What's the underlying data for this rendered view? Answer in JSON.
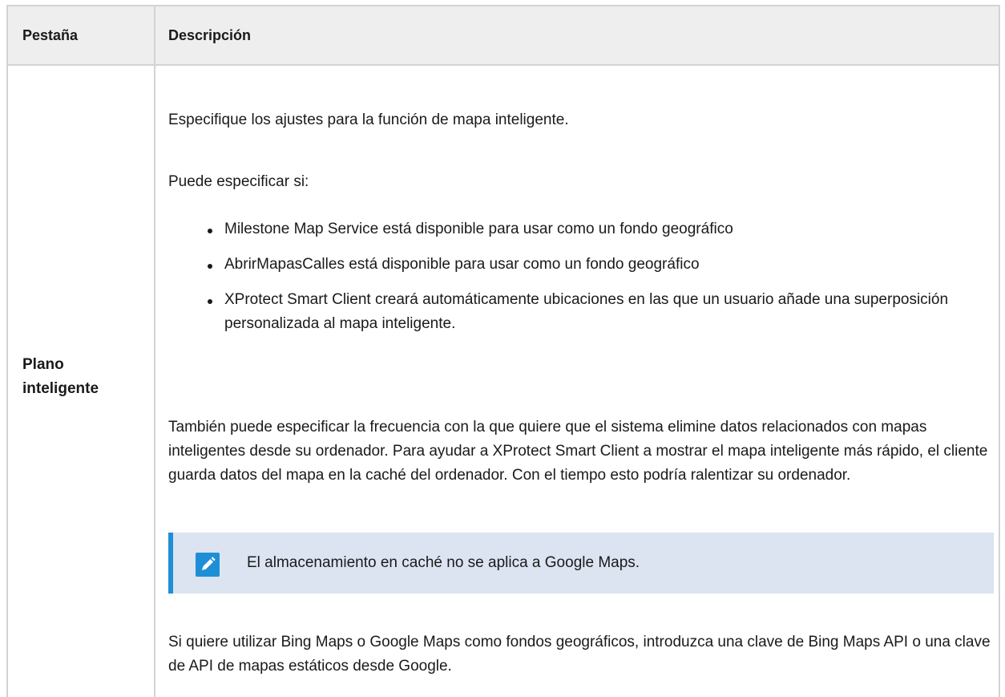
{
  "table": {
    "header": {
      "tab_label": "Pestaña",
      "description_label": "Descripción"
    },
    "row": {
      "tab_name": "Plano inteligente",
      "intro": "Especifique los ajustes para la función de mapa inteligente.",
      "lead": "Puede especificar si:",
      "bullets": [
        "Milestone Map Service está disponible para usar como un fondo geográfico",
        "AbrirMapasCalles está disponible para usar como un fondo geográfico",
        "XProtect Smart Client creará automáticamente ubicaciones en las que un usuario añade una superposición personalizada al mapa inteligente."
      ],
      "frequency_paragraph": "También puede especificar la frecuencia con la que quiere que el sistema elimine datos relacionados con mapas inteligentes desde su ordenador. Para ayudar a XProtect Smart Client a mostrar el mapa inteligente más rápido, el cliente guarda datos del mapa en la caché del ordenador. Con el tiempo esto podría ralentizar su ordenador.",
      "note": {
        "icon": "pencil-icon",
        "text": "El almacenamiento en caché no se aplica a Google Maps."
      },
      "api_paragraph": "Si quiere utilizar Bing Maps o Google Maps como fondos geográficos, introduzca una clave de Bing Maps API o una clave de API de mapas estáticos desde Google."
    }
  },
  "colors": {
    "header_bg": "#eeeeee",
    "border": "#d3d3d3",
    "note_bg": "#dce4f1",
    "accent": "#1e8fd6"
  }
}
